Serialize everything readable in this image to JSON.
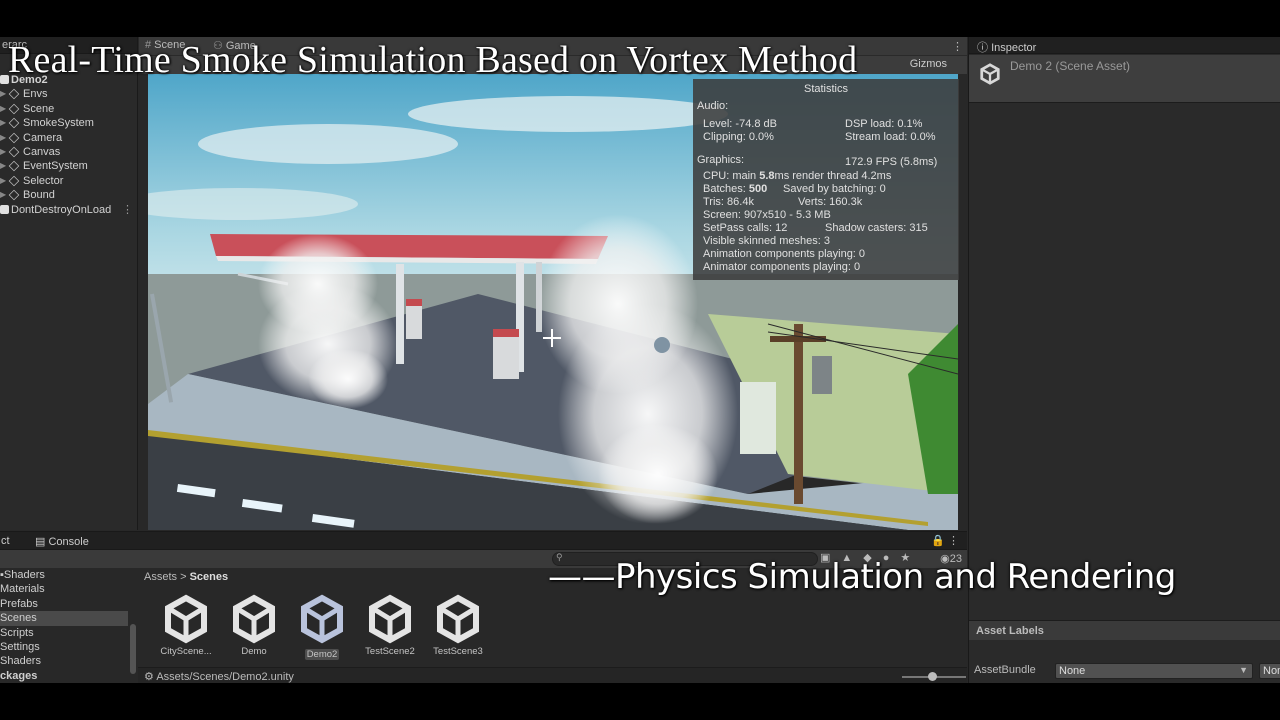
{
  "overlay": {
    "title": "Real-Time Smoke Simulation Based on Vortex Method",
    "subtitle": "——Physics Simulation and Rendering"
  },
  "hierarchy": {
    "tab_label": "erarc",
    "root": "Demo2",
    "items": [
      "Envs",
      "Scene",
      "SmokeSystem",
      "Camera",
      "Canvas",
      "EventSystem",
      "Selector",
      "Bound"
    ],
    "second_root": "DontDestroyOnLoad",
    "more_glyph": "⋮"
  },
  "view": {
    "tabs": [
      {
        "icon": "#",
        "label": "Scene"
      },
      {
        "icon": "⚇",
        "label": "Game"
      }
    ],
    "gizmos_label": "Gizmos",
    "menu_glyph": "⋮"
  },
  "stats": {
    "title": "Statistics",
    "audio_label": "Audio:",
    "level": "Level: -74.8 dB",
    "clipping": "Clipping: 0.0%",
    "dsp": "DSP load: 0.1%",
    "stream": "Stream load: 0.0%",
    "graphics_label": "Graphics:",
    "fps": "172.9 FPS (5.8ms)",
    "cpu_prefix": "CPU: main",
    "cpu_main": "5.8",
    "cpu_suffix": "ms  render thread 4.2ms",
    "batches_prefix": "Batches:",
    "batches": "500",
    "saved": "Saved by batching: 0",
    "tris": "Tris: 86.4k",
    "verts": "Verts: 160.3k",
    "screen": "Screen: 907x510 - 5.3 MB",
    "setpass": "SetPass calls: 12",
    "shadow": "Shadow casters: 315",
    "skinned": "Visible skinned meshes: 3",
    "anim": "Animation components playing: 0",
    "animator": "Animator components playing: 0"
  },
  "inspector": {
    "tab_label": "Inspector",
    "header": "Demo 2 (Scene Asset)",
    "asset_labels": "Asset Labels",
    "assetbundle_label": "AssetBundle",
    "assetbundle_value": "None",
    "assetbundle_variant": "Non"
  },
  "project": {
    "tab_project": "ct",
    "tab_console": "Console",
    "search_count": "23",
    "tree": [
      {
        "label": "Shaders",
        "selected": false,
        "bold": false
      },
      {
        "label": "Materials",
        "selected": false,
        "bold": false
      },
      {
        "label": "Prefabs",
        "selected": false,
        "bold": false
      },
      {
        "label": "Scenes",
        "selected": true,
        "bold": false
      },
      {
        "label": "Scripts",
        "selected": false,
        "bold": false
      },
      {
        "label": "Settings",
        "selected": false,
        "bold": false
      },
      {
        "label": "Shaders",
        "selected": false,
        "bold": false
      },
      {
        "label": "ckages",
        "selected": false,
        "bold": true
      }
    ],
    "breadcrumb_root": "Assets",
    "breadcrumb_sep": ">",
    "breadcrumb_current": "Scenes",
    "assets": [
      {
        "label": "CityScene...",
        "selected": false
      },
      {
        "label": "Demo",
        "selected": false
      },
      {
        "label": "Demo2",
        "selected": true
      },
      {
        "label": "TestScene2",
        "selected": false
      },
      {
        "label": "TestScene3",
        "selected": false
      }
    ],
    "footer_path": "Assets/Scenes/Demo2.unity"
  },
  "colors": {
    "editor_bg": "#282828",
    "stats_bg": "#3c3c3c",
    "roof_red": "#c95058",
    "sky": "#9ecfe0",
    "grass": "#4f9a3a"
  }
}
